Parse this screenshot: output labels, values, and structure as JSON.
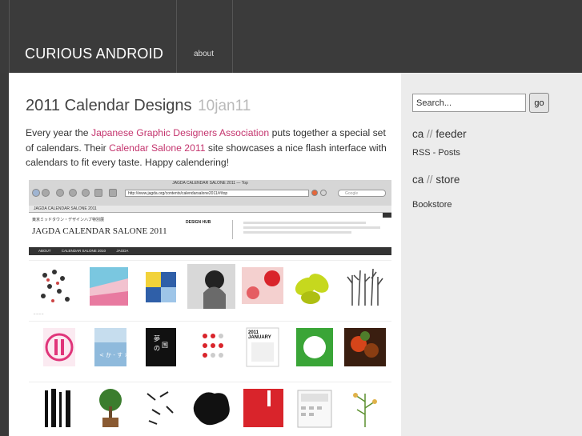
{
  "header": {
    "site_title": "CURIOUS ANDROID",
    "nav": [
      {
        "label": "about"
      }
    ]
  },
  "post": {
    "title": "2011 Calendar Designs",
    "date": "10jan11",
    "body": {
      "p1": "Every year the ",
      "link1": "Japanese Graphic Designers Association",
      "p2": " puts together a special set of calendars. Their ",
      "link2": "Calendar Salone 2011",
      "p3": " site showcases a nice flash interface with calendars to fit every taste. Happy calendering!"
    }
  },
  "screenshot": {
    "window_title": "JAGDA CALENDAR SALONE 2011 — Top",
    "url": "http://www.jagda.org/contents/calendarsalone2011/#/top",
    "search_placeholder": "Google",
    "tab_label": "JAGDA CALENDAR SALONE 2011",
    "header_small": "東京ミッドタウン・デザインハブ特別展",
    "site_name": "JAGDA CALENDAR SALONE 2011",
    "hub_label": "DESIGN HUB",
    "nav": [
      "ABOUT",
      "CALENDAR SALONE 2010",
      "JAGDA"
    ],
    "tiles_row1": [
      "",
      "",
      "",
      "",
      "",
      "",
      "",
      ""
    ],
    "tiles_row2": [
      "",
      "",
      "",
      "",
      "2011 JANUARY",
      "",
      "",
      ""
    ],
    "tiles_row3": [
      "",
      "",
      "",
      "",
      "",
      "",
      "",
      ""
    ],
    "colors": {
      "accent_pink": "#e0357a",
      "lime": "#c6d81e",
      "red": "#d9242b"
    }
  },
  "sidebar": {
    "search": {
      "value": "Search...",
      "button": "go"
    },
    "feeder": {
      "prefix": "ca",
      "sep": "//",
      "name": "feeder",
      "link": "RSS - Posts"
    },
    "store": {
      "prefix": "ca",
      "sep": "//",
      "name": "store",
      "link": "Bookstore"
    }
  },
  "colors": {
    "header_bg": "#3b3b3b",
    "link": "#c4356e",
    "date": "#b9b9b9"
  }
}
